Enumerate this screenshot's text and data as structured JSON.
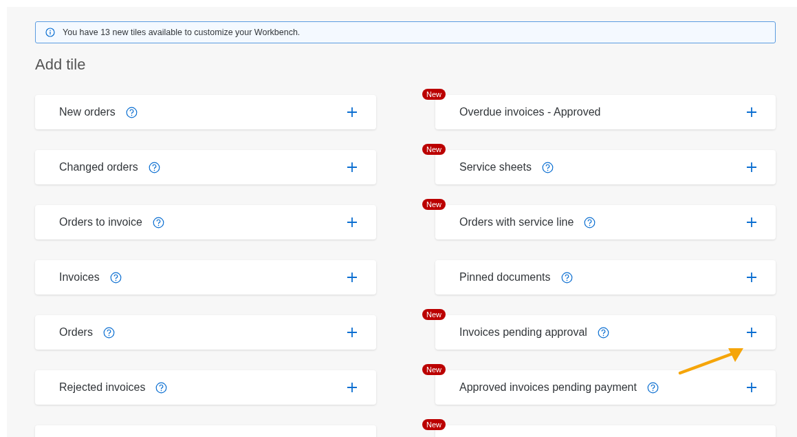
{
  "banner": {
    "text": "You have 13 new tiles available to customize your Workbench."
  },
  "title": "Add tile",
  "tiles": [
    {
      "kind": "full",
      "label": "New orders",
      "help": true
    },
    {
      "kind": "full",
      "label": "Overdue invoices - Approved",
      "help": false,
      "badge": "New"
    },
    {
      "kind": "full",
      "label": "Changed orders",
      "help": true
    },
    {
      "kind": "full",
      "label": "Service sheets",
      "help": true,
      "badge": "New"
    },
    {
      "kind": "full",
      "label": "Orders to invoice",
      "help": true
    },
    {
      "kind": "full",
      "label": "Orders with service line",
      "help": true,
      "badge": "New"
    },
    {
      "kind": "full",
      "label": "Invoices",
      "help": true
    },
    {
      "kind": "full",
      "label": "Pinned documents",
      "help": true
    },
    {
      "kind": "full",
      "label": "Orders",
      "help": true
    },
    {
      "kind": "full",
      "label": "Invoices pending approval",
      "help": true,
      "badge": "New"
    },
    {
      "kind": "full",
      "label": "Rejected invoices",
      "help": true
    },
    {
      "kind": "full",
      "label": "Approved invoices pending payment",
      "help": true,
      "badge": "New"
    },
    {
      "kind": "cut"
    },
    {
      "kind": "cut",
      "badge": "New"
    }
  ]
}
